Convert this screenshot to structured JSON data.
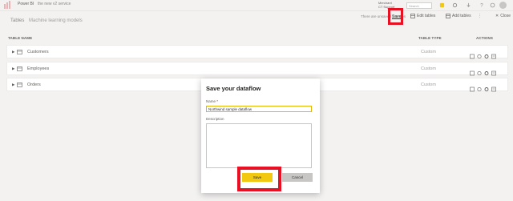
{
  "app": {
    "name": "Power BI",
    "workspace": "the new v2 service",
    "user_line1": "Merchant",
    "user_line2": "CT Support",
    "search_placeholder": "Search"
  },
  "tabs": [
    {
      "label": "Tables"
    },
    {
      "label": "Machine learning models"
    }
  ],
  "toolbar": {
    "unsaved_text": "There are unsaved changes",
    "save_label": "Save",
    "edit_tables_label": "Edit tables",
    "add_tables_label": "Add tables",
    "close_label": "Close"
  },
  "table": {
    "headers": {
      "name": "TABLE NAME",
      "type": "TABLE TYPE",
      "actions": "ACTIONS"
    },
    "rows": [
      {
        "name": "Customers",
        "type": "Custom"
      },
      {
        "name": "Employees",
        "type": "Custom"
      },
      {
        "name": "Orders",
        "type": "Custom"
      }
    ]
  },
  "dialog": {
    "title": "Save your dataflow",
    "name_label": "Name",
    "required_mark": "*",
    "name_value": "Northwind sample dataflow",
    "description_label": "Description",
    "description_value": "",
    "save_label": "Save",
    "cancel_label": "Cancel"
  },
  "colors": {
    "accent_yellow": "#f2c811",
    "highlight_red": "#e81123"
  }
}
